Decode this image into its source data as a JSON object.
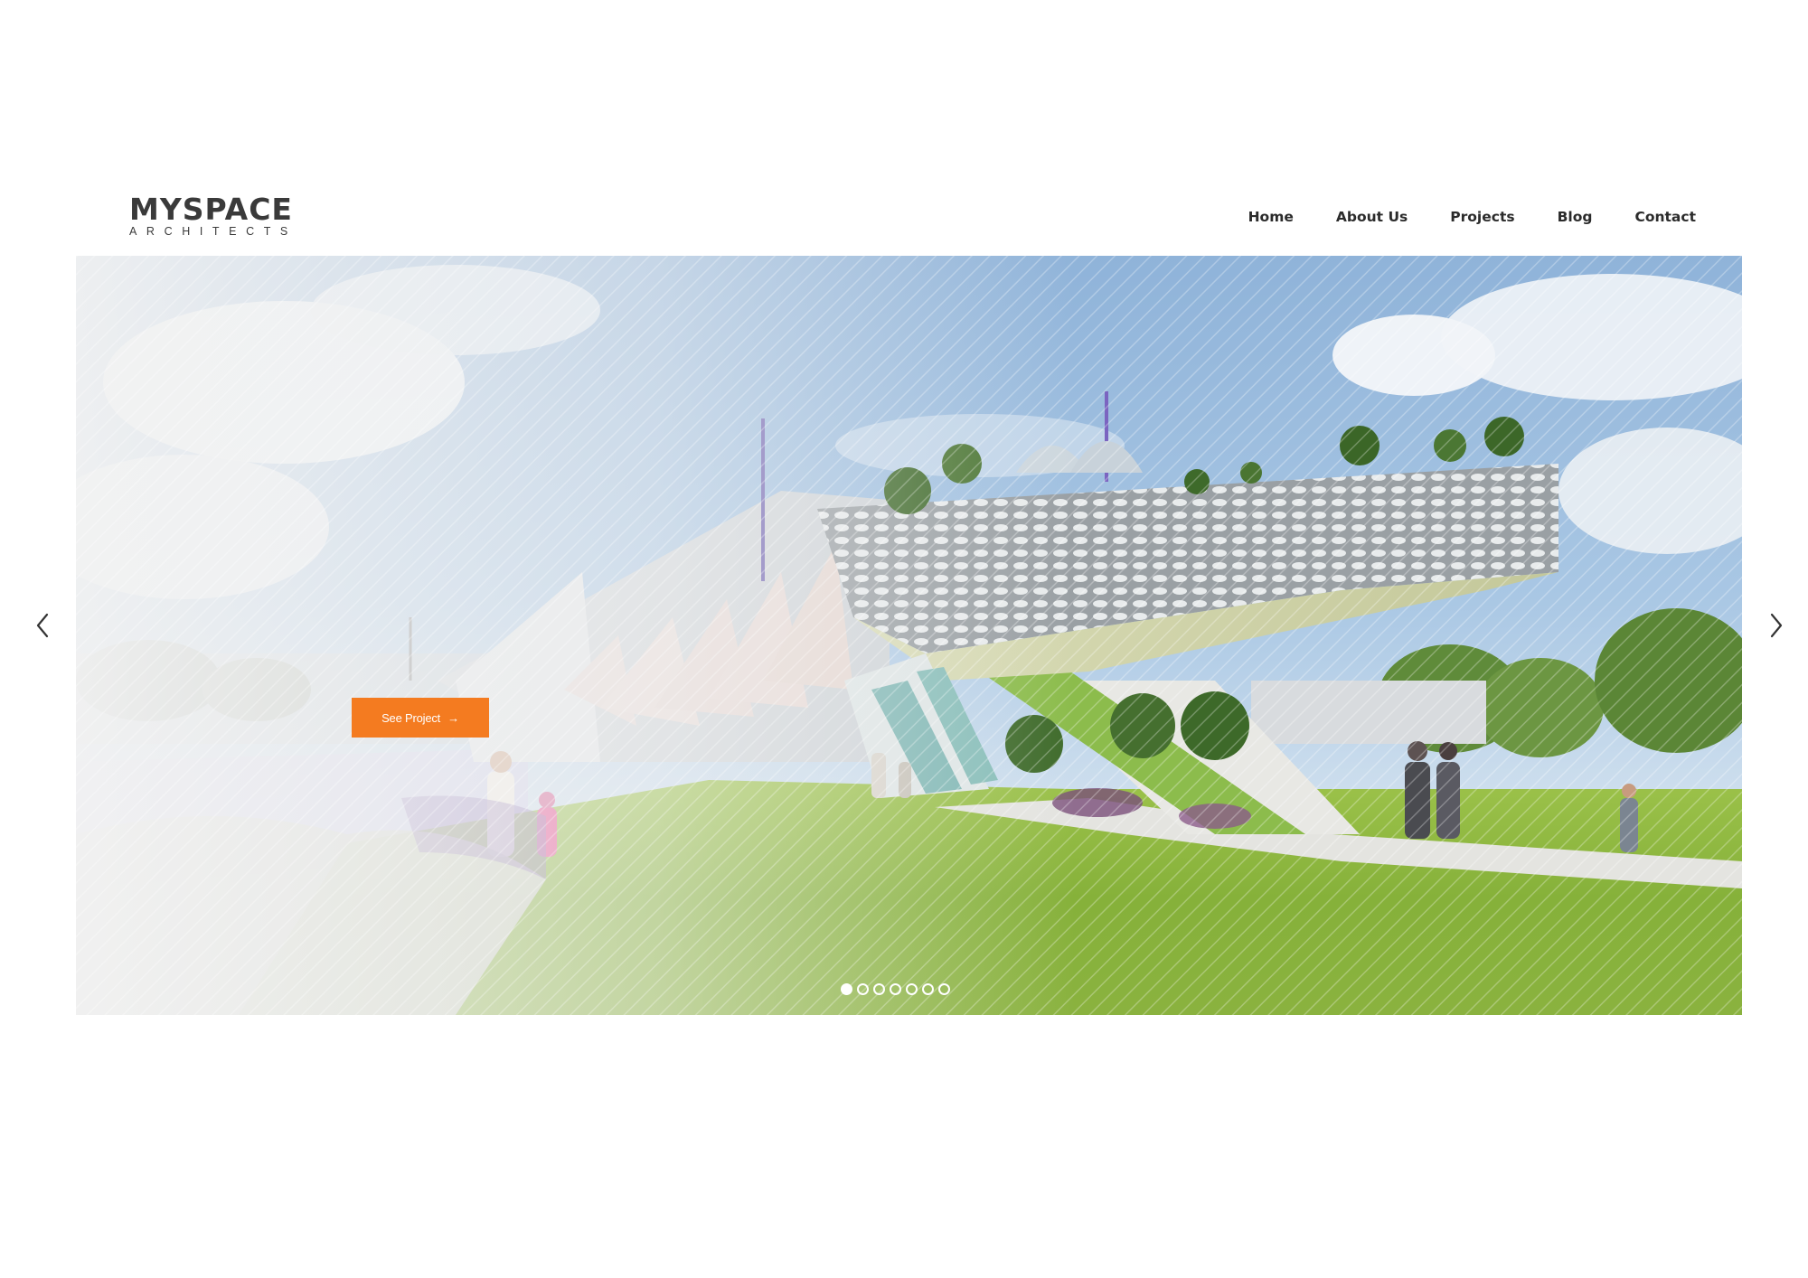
{
  "brand": {
    "name": "MYSPACE",
    "tagline": "ARCHITECTS"
  },
  "nav": {
    "items": [
      {
        "label": "Home"
      },
      {
        "label": "About Us"
      },
      {
        "label": "Projects"
      },
      {
        "label": "Blog"
      },
      {
        "label": "Contact"
      }
    ]
  },
  "hero": {
    "cta_label": "See Project",
    "cta_icon": "arrow-right-icon",
    "slides_total": 7,
    "active_slide": 1,
    "prev_icon": "chevron-left-icon",
    "next_icon": "chevron-right-icon"
  },
  "colors": {
    "accent": "#f47b20",
    "text": "#2b2b2b",
    "logo": "#3a3a3a"
  }
}
